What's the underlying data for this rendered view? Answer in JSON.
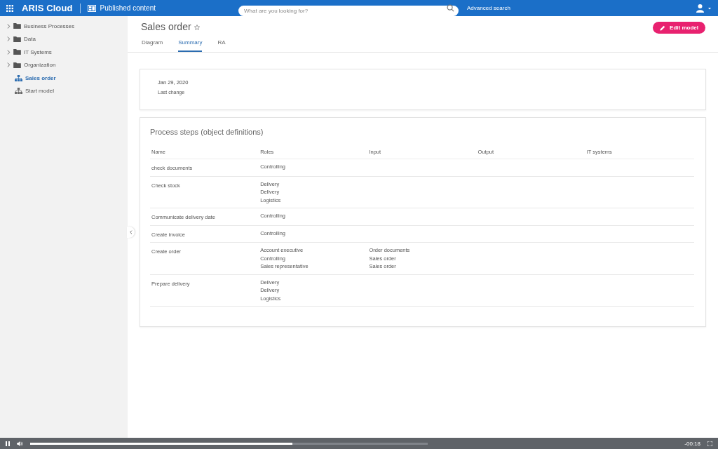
{
  "header": {
    "app_name": "ARIS Cloud",
    "section": "Published content",
    "search": {
      "placeholder": "What are you looking for?"
    },
    "advanced_search": "Advanced search"
  },
  "sidebar": {
    "items": [
      {
        "kind": "folder",
        "label": "Business Processes",
        "selected": false
      },
      {
        "kind": "folder",
        "label": "Data",
        "selected": false
      },
      {
        "kind": "folder",
        "label": "IT Systems",
        "selected": false
      },
      {
        "kind": "folder",
        "label": "Organization",
        "selected": false
      },
      {
        "kind": "model",
        "label": "Sales order",
        "selected": true
      },
      {
        "kind": "model",
        "label": "Start model",
        "selected": false
      }
    ]
  },
  "page": {
    "title": "Sales order",
    "edit_button": "Edit model",
    "tabs": [
      {
        "label": "Diagram",
        "selected": false
      },
      {
        "label": "Summary",
        "selected": true
      },
      {
        "label": "RA",
        "selected": false
      }
    ]
  },
  "info_card": {
    "date": "Jan 29, 2020",
    "caption": "Last change"
  },
  "process_steps": {
    "title": "Process steps (object definitions)",
    "columns": [
      "Name",
      "Roles",
      "Input",
      "Output",
      "IT systems"
    ],
    "rows": [
      {
        "name": "check documents",
        "roles": [
          "Controlling"
        ],
        "input": []
      },
      {
        "name": "Check stock",
        "roles": [
          "Delivery",
          "Delivery",
          "Logistics"
        ],
        "input": []
      },
      {
        "name": "Communicate delivery date",
        "roles": [
          "Controlling"
        ],
        "input": []
      },
      {
        "name": "Create invoice",
        "roles": [
          "Controlling"
        ],
        "input": []
      },
      {
        "name": "Create order",
        "roles": [
          "Account executive",
          "Controlling",
          "Sales representative"
        ],
        "input": [
          "Order documents",
          "Sales order",
          "Sales order"
        ]
      },
      {
        "name": "Prepare delivery",
        "roles": [
          "Delivery",
          "Delivery",
          "Logistics"
        ],
        "input": []
      }
    ]
  },
  "video_bar": {
    "progress": {
      "level": 0.66
    },
    "time": "-00:18"
  }
}
